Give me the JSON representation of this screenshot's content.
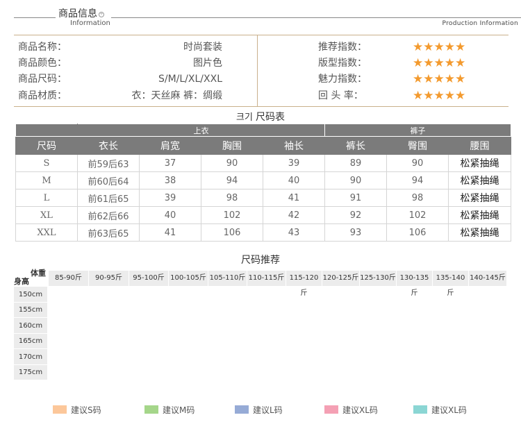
{
  "header": {
    "title": "商品信息",
    "subtitle": "Information",
    "right_caption": "Production Information"
  },
  "info": {
    "left": [
      {
        "label": "商品名称：",
        "value": "时尚套装"
      },
      {
        "label": "商品颜色：",
        "value": "图片色"
      },
      {
        "label": "商品尺码：",
        "value": "S/M/L/XL/XXL"
      },
      {
        "label": "商品材质：",
        "value": "衣：天丝麻 裤：绸缎"
      }
    ],
    "right": [
      {
        "label": "推荐指数：",
        "stars": "★★★★★",
        "rating": 5
      },
      {
        "label": "版型指数：",
        "stars": "★★★★★",
        "rating": 5
      },
      {
        "label": "魅力指数：",
        "stars": "★★★★★",
        "rating": 5
      },
      {
        "label": "回  头  率：",
        "stars": "★★★★★",
        "rating": 5
      }
    ],
    "star_color": "#f39a2e"
  },
  "size_table": {
    "title_kr": "크기",
    "title": "尺码表",
    "group_top": "上衣",
    "group_pants": "裤子",
    "headers": [
      "尺码",
      "衣长",
      "肩宽",
      "胸围",
      "袖长",
      "裤长",
      "臀围",
      "腰围"
    ],
    "rows": [
      [
        "S",
        "前59后63",
        "37",
        "90",
        "39",
        "89",
        "90",
        "松紧抽绳"
      ],
      [
        "M",
        "前60后64",
        "38",
        "94",
        "40",
        "90",
        "94",
        "松紧抽绳"
      ],
      [
        "L",
        "前61后65",
        "39",
        "98",
        "41",
        "91",
        "98",
        "松紧抽绳"
      ],
      [
        "XL",
        "前62后66",
        "40",
        "102",
        "42",
        "92",
        "102",
        "松紧抽绳"
      ],
      [
        "XXL",
        "前63后65",
        "41",
        "106",
        "43",
        "93",
        "106",
        "松紧抽绳"
      ]
    ]
  },
  "recommend": {
    "title": "尺码推荐",
    "corner_weight": "体重",
    "corner_height": "身高",
    "weights": [
      "85-90斤",
      "90-95斤",
      "95-100斤",
      "100-105斤",
      "105-110斤",
      "110-115斤",
      "115-120斤",
      "120-125斤",
      "125-130斤",
      "130-135斤",
      "135-140斤",
      "140-145斤"
    ],
    "heights": [
      "150cm",
      "155cm",
      "160cm",
      "165cm",
      "170cm",
      "175cm"
    ],
    "sizes": [
      {
        "label": "S",
        "color": "#f7a856"
      },
      {
        "label": "M",
        "color": "#a5d68a"
      },
      {
        "label": "L",
        "color": "#96abd6"
      },
      {
        "label": "XL",
        "color": "#f4a0b4"
      },
      {
        "label": "XXL",
        "color": "#8bd6d4"
      }
    ]
  },
  "legend": [
    {
      "label": "建议S码",
      "color": "#fcc79a"
    },
    {
      "label": "建议M码",
      "color": "#a5d68a"
    },
    {
      "label": "建议L码",
      "color": "#96abd6"
    },
    {
      "label": "建议XL码",
      "color": "#f4a0b4"
    },
    {
      "label": "建议XL码",
      "color": "#8bd6d4"
    }
  ]
}
